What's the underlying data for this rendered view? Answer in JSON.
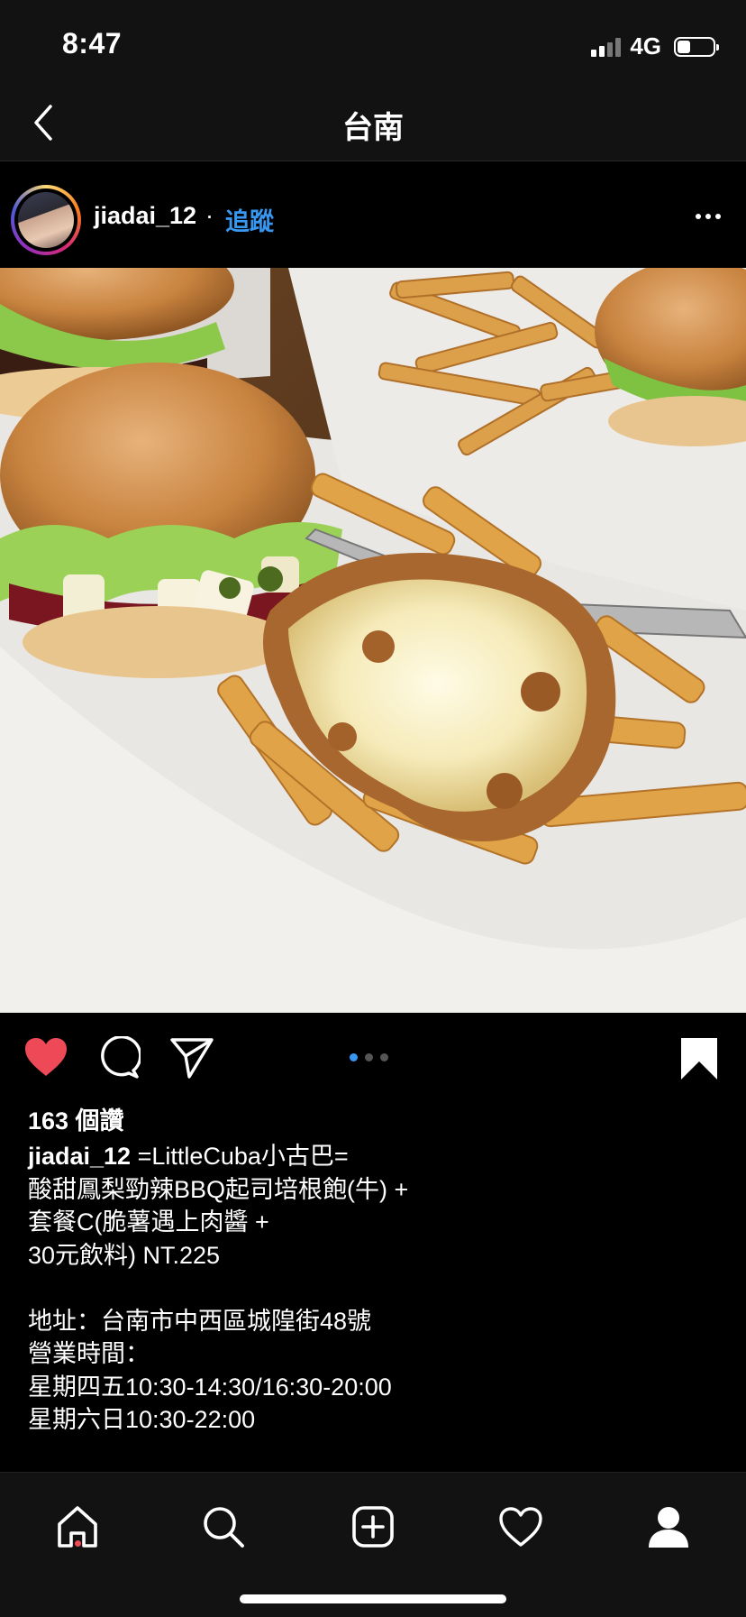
{
  "status_bar": {
    "time": "8:47",
    "network": "4G",
    "signal_bars": 2,
    "battery_level": 0.3
  },
  "header": {
    "title": "台南",
    "back_icon": "chevron-left-icon"
  },
  "post": {
    "username": "jiadai_12",
    "separator": "·",
    "follow_label": "追蹤",
    "more_icon": "more-horizontal-icon",
    "image_description_icon": "food-photo",
    "carousel": {
      "count": 3,
      "active_index": 0
    },
    "liked": true,
    "saved": true,
    "likes_text": "163 個讚",
    "caption_user": "jiadai_12",
    "caption_text": " =LittleCuba小古巴=\n酸甜鳳梨勁辣BBQ起司培根飽(牛) +\n套餐C(脆薯遇上肉醬 +\n30元飲料) NT.225\n\n地址：台南市中西區城隍街48號\n營業時間：\n星期四五10:30-14:30/16:30-20:00\n星期六日10:30-22:00",
    "colors": {
      "like": "#ed4956",
      "follow": "#3897f0",
      "active_dot": "#3897f0"
    }
  },
  "tab_bar": {
    "items": [
      "home-icon",
      "search-icon",
      "new-post-icon",
      "activity-heart-icon",
      "profile-icon"
    ],
    "home_has_notification": true
  }
}
